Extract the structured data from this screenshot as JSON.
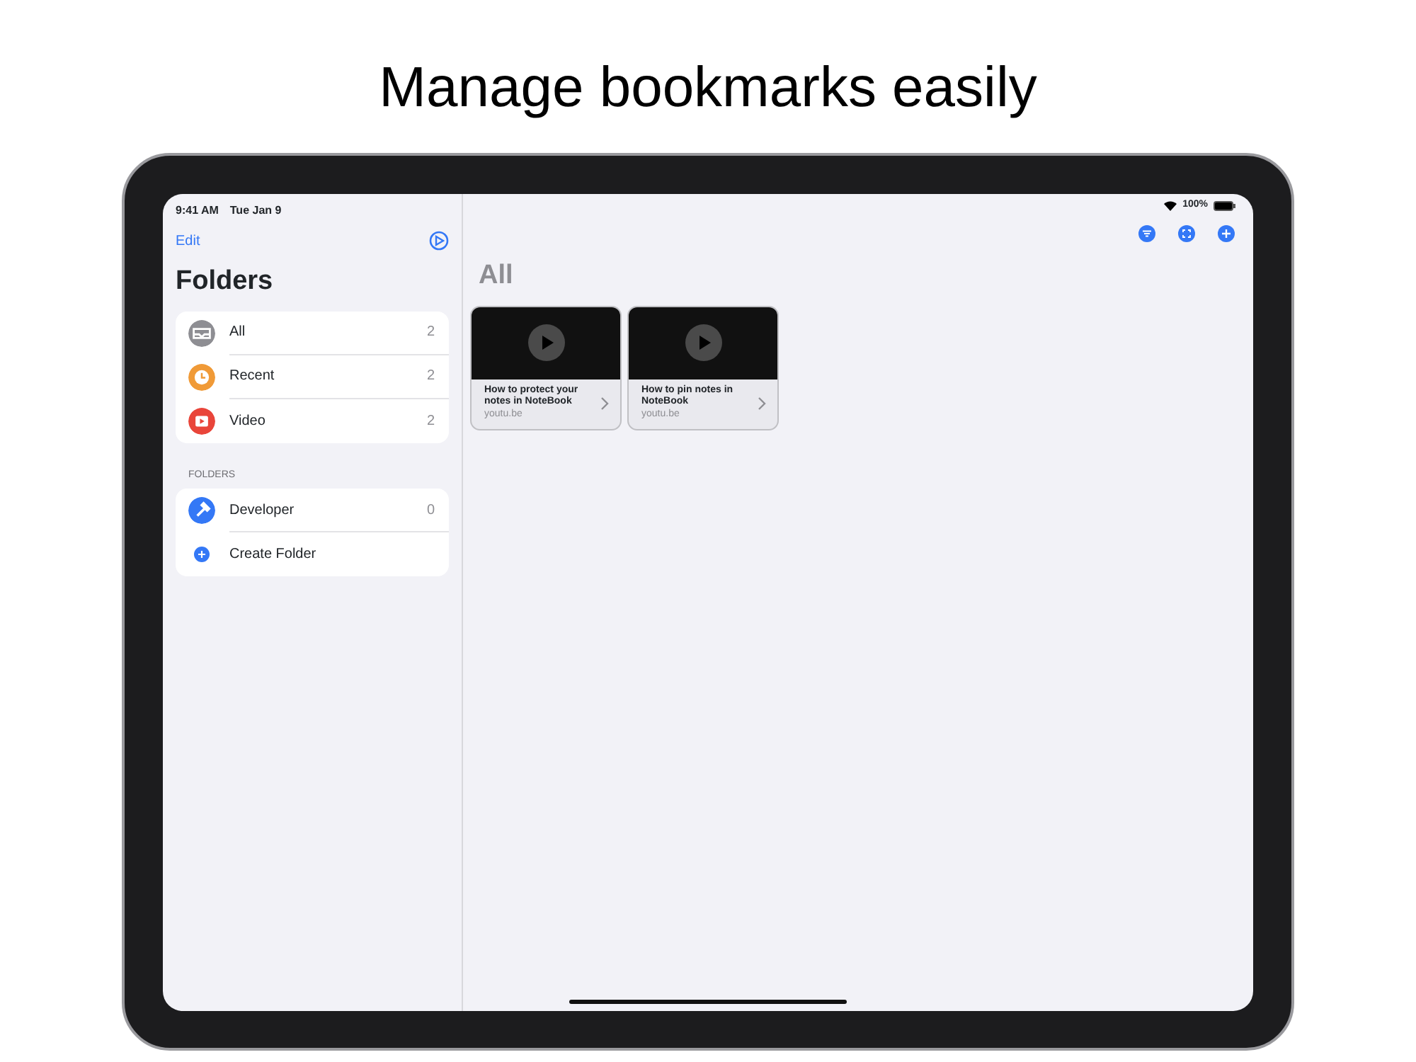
{
  "headline": "Manage bookmarks easily",
  "status_bar": {
    "time": "9:41 AM",
    "date": "Tue Jan 9",
    "battery": "100%"
  },
  "sidebar": {
    "edit": "Edit",
    "title": "Folders",
    "smart_folders": [
      {
        "label": "All",
        "count": "2",
        "kind": "tray",
        "color": "#8e8e93"
      },
      {
        "label": "Recent",
        "count": "2",
        "kind": "clock",
        "color": "#f09a37"
      },
      {
        "label": "Video",
        "count": "2",
        "kind": "play",
        "color": "#e9453a"
      }
    ],
    "section_header": "FOLDERS",
    "folders": [
      {
        "label": "Developer",
        "count": "0",
        "kind": "hammer",
        "color": "#3478f6"
      }
    ],
    "create_folder": "Create Folder"
  },
  "detail": {
    "title": "All",
    "cards": [
      {
        "title": "How to protect your notes in NoteBook",
        "domain": "youtu.be"
      },
      {
        "title": "How to pin notes in NoteBook",
        "domain": "youtu.be"
      }
    ]
  }
}
